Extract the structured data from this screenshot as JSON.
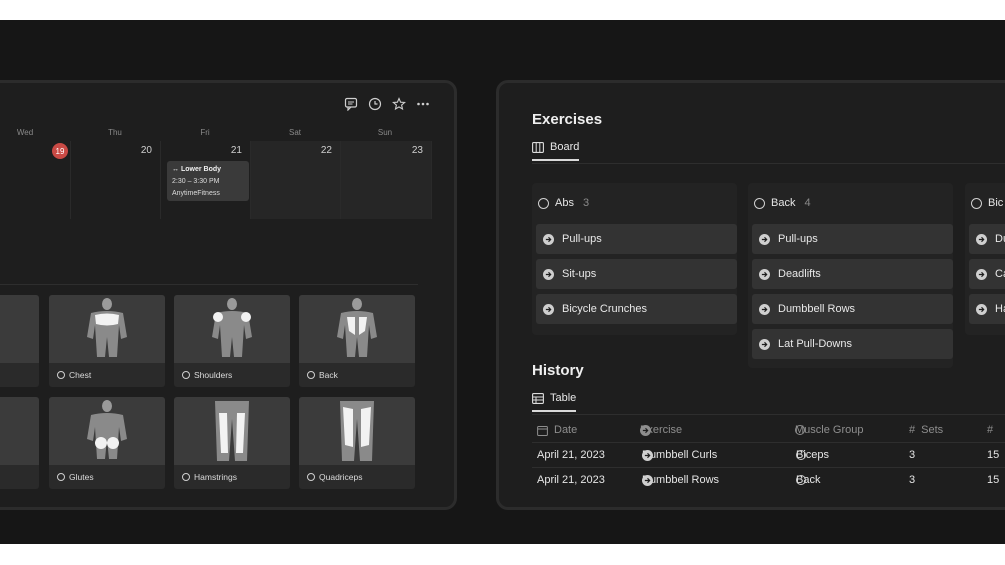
{
  "calendar": {
    "toolbar_icons": [
      "comment-icon",
      "clock-icon",
      "star-icon",
      "more-icon"
    ],
    "weekdays": [
      "Wed",
      "Thu",
      "Fri",
      "Sat",
      "Sun"
    ],
    "days": [
      {
        "num": "19",
        "today": true
      },
      {
        "num": "20"
      },
      {
        "num": "21"
      },
      {
        "num": "22"
      },
      {
        "num": "23"
      }
    ],
    "event": {
      "title": "Lower Body",
      "time": "2:30 – 3:30 PM",
      "location": "AnytimeFitness"
    }
  },
  "muscles": {
    "row1": [
      "Chest",
      "Shoulders",
      "Back"
    ],
    "row2": [
      "Glutes",
      "Hamstrings",
      "Quadriceps"
    ]
  },
  "exercises": {
    "title": "Exercises",
    "view_tab": "Board",
    "columns": [
      {
        "name": "Abs",
        "count": "3",
        "cards": [
          "Pull-ups",
          "Sit-ups",
          "Bicycle Crunches"
        ]
      },
      {
        "name": "Back",
        "count": "4",
        "cards": [
          "Pull-ups",
          "Deadlifts",
          "Dumbbell Rows",
          "Lat Pull-Downs"
        ]
      },
      {
        "name": "Bic",
        "count": "",
        "cards": [
          "Du",
          "Ca",
          "Ha"
        ]
      }
    ]
  },
  "history": {
    "title": "History",
    "view_tab": "Table",
    "headers": [
      "Date",
      "Exercise",
      "Muscle Group",
      "Sets",
      "#"
    ],
    "rows": [
      {
        "date": "April 21, 2023",
        "exercise": "Dumbbell Curls",
        "muscle": "Biceps",
        "sets": "3",
        "reps": "15"
      },
      {
        "date": "April 21, 2023",
        "exercise": "Dumbbell Rows",
        "muscle": "Back",
        "sets": "3",
        "reps": "15"
      }
    ]
  },
  "colors": {
    "background": "#161616",
    "panel": "#1e1e1e",
    "card": "#333333",
    "today_badge": "#c94a45"
  }
}
